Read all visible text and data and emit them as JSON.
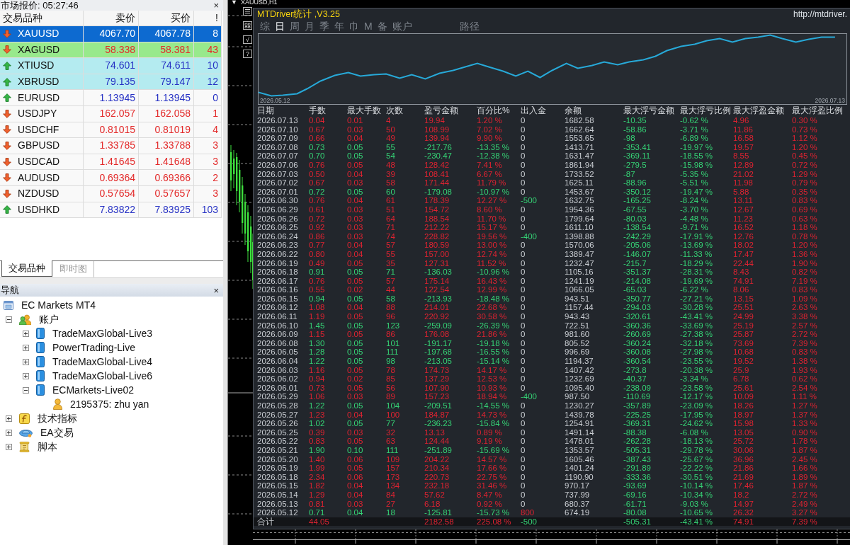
{
  "market_watch": {
    "title": "市场报价: 05:27:46",
    "close": "×",
    "columns": [
      "交易品种",
      "卖价",
      "买价",
      "!"
    ],
    "rows": [
      {
        "symbol": "XAUUSD",
        "bid": "4067.70",
        "ask": "4067.78",
        "spread": "8",
        "kind": "down",
        "selected": true
      },
      {
        "symbol": "XAGUSD",
        "bid": "58.338",
        "ask": "58.381",
        "spread": "43",
        "kind": "down",
        "selected": false,
        "color": "#98e98c"
      },
      {
        "symbol": "XTIUSD",
        "bid": "74.601",
        "ask": "74.611",
        "spread": "10",
        "kind": "up",
        "selected": false,
        "color": "#b4ebf0"
      },
      {
        "symbol": "XBRUSD",
        "bid": "79.135",
        "ask": "79.147",
        "spread": "12",
        "kind": "up",
        "selected": false,
        "color": "#b4ebf0"
      },
      {
        "symbol": "EURUSD",
        "bid": "1.13945",
        "ask": "1.13945",
        "spread": "0",
        "kind": "up",
        "selected": false
      },
      {
        "symbol": "USDJPY",
        "bid": "162.057",
        "ask": "162.058",
        "spread": "1",
        "kind": "down",
        "selected": false
      },
      {
        "symbol": "USDCHF",
        "bid": "0.81015",
        "ask": "0.81019",
        "spread": "4",
        "kind": "down",
        "selected": false
      },
      {
        "symbol": "GBPUSD",
        "bid": "1.33785",
        "ask": "1.33788",
        "spread": "3",
        "kind": "down",
        "selected": false
      },
      {
        "symbol": "USDCAD",
        "bid": "1.41645",
        "ask": "1.41648",
        "spread": "3",
        "kind": "down",
        "selected": false
      },
      {
        "symbol": "AUDUSD",
        "bid": "0.69364",
        "ask": "0.69366",
        "spread": "2",
        "kind": "down",
        "selected": false
      },
      {
        "symbol": "NZDUSD",
        "bid": "0.57654",
        "ask": "0.57657",
        "spread": "3",
        "kind": "down",
        "selected": false
      },
      {
        "symbol": "USDHKD",
        "bid": "7.83822",
        "ask": "7.83925",
        "spread": "103",
        "kind": "up",
        "selected": false
      }
    ]
  },
  "panel_tabs": [
    {
      "label": "交易品种",
      "selected": true
    },
    {
      "label": "即时图",
      "selected": false
    }
  ],
  "navigator": {
    "title": "导航",
    "close": "×",
    "tree": [
      {
        "kind": "terminal",
        "label": "EC Markets MT4",
        "children": [
          {
            "kind": "accounts",
            "label": "账户",
            "expanded": true,
            "children": [
              {
                "kind": "server",
                "label": "TradeMaxGlobal-Live3",
                "expanded": false
              },
              {
                "kind": "server",
                "label": "PowerTrading-Live",
                "expanded": false
              },
              {
                "kind": "server",
                "label": "TradeMaxGlobal-Live4",
                "expanded": false
              },
              {
                "kind": "server",
                "label": "TradeMaxGlobal-Live6",
                "expanded": false
              },
              {
                "kind": "server",
                "label": "ECMarkets-Live02",
                "expanded": true,
                "children": [
                  {
                    "kind": "account",
                    "label": "2195375: zhu yan"
                  }
                ]
              }
            ]
          },
          {
            "kind": "indicators",
            "label": "技术指标",
            "expanded": false
          },
          {
            "kind": "experts",
            "label": "EA交易",
            "expanded": false
          },
          {
            "kind": "scripts",
            "label": "脚本",
            "expanded": false
          }
        ]
      }
    ]
  },
  "chart": {
    "caret": "▼",
    "symbol": "XAUUSD,H1",
    "tools": [
      "√",
      "?"
    ]
  },
  "stats_window": {
    "title": "MTDriver统计 ,V3.25",
    "link": "http://mtdriver.",
    "tabs": [
      {
        "label": "综",
        "selected": false
      },
      {
        "label": "日",
        "selected": true
      },
      {
        "label": "周",
        "selected": false
      },
      {
        "label": "月",
        "selected": false
      },
      {
        "label": "季",
        "selected": false
      },
      {
        "label": "年",
        "selected": false
      },
      {
        "label": "巾",
        "selected": false
      },
      {
        "label": "M",
        "selected": false
      },
      {
        "label": "备",
        "selected": false
      },
      {
        "label": "账户",
        "selected": false
      }
    ],
    "path_button": "路径",
    "curve": {
      "start_label": "2026.05.12",
      "end_label": "2026.07.13"
    },
    "table": {
      "columns": [
        "日期",
        "手数",
        "最大手数",
        "次数",
        "盈亏金额",
        "百分比%",
        "出入金",
        "余额",
        "最大浮亏金额",
        "最大浮亏比例",
        "最大浮盈金额",
        "最大浮盈比例"
      ],
      "rows": [
        {
          "cells": [
            "2026.07.13",
            "0.04",
            "0.01",
            "4",
            "19.94",
            "1.20 %",
            "0",
            "1682.58",
            "-10.35",
            "-0.62 %",
            "4.96",
            "0.30 %"
          ],
          "kind": "gain",
          "withdrawal": false,
          "deposit": false
        },
        {
          "cells": [
            "2026.07.10",
            "0.67",
            "0.03",
            "50",
            "108.99",
            "7.02 %",
            "0",
            "1662.64",
            "-58.86",
            "-3.71 %",
            "11.86",
            "0.73 %"
          ],
          "kind": "gain",
          "withdrawal": false,
          "deposit": false
        },
        {
          "cells": [
            "2026.07.09",
            "0.66",
            "0.04",
            "49",
            "139.94",
            "9.90 %",
            "0",
            "1553.65",
            "-98",
            "-6.89 %",
            "16.58",
            "1.12 %"
          ],
          "kind": "gain",
          "withdrawal": false,
          "deposit": false
        },
        {
          "cells": [
            "2026.07.08",
            "0.73",
            "0.05",
            "55",
            "-217.76",
            "-13.35 %",
            "0",
            "1413.71",
            "-353.41",
            "-19.97 %",
            "19.57",
            "1.20 %"
          ],
          "kind": "loss",
          "withdrawal": false,
          "deposit": false
        },
        {
          "cells": [
            "2026.07.07",
            "0.70",
            "0.05",
            "54",
            "-230.47",
            "-12.38 %",
            "0",
            "1631.47",
            "-369.11",
            "-18.55 %",
            "8.55",
            "0.45 %"
          ],
          "kind": "loss",
          "withdrawal": false,
          "deposit": false
        },
        {
          "cells": [
            "2026.07.06",
            "0.76",
            "0.05",
            "48",
            "128.42",
            "7.41 %",
            "0",
            "1861.94",
            "-279.5",
            "-15.98 %",
            "12.89",
            "0.72 %"
          ],
          "kind": "gain",
          "withdrawal": false,
          "deposit": false
        },
        {
          "cells": [
            "2026.07.03",
            "0.50",
            "0.04",
            "39",
            "108.41",
            "6.67 %",
            "0",
            "1733.52",
            "-87",
            "-5.35 %",
            "21.02",
            "1.29 %"
          ],
          "kind": "gain",
          "withdrawal": false,
          "deposit": false
        },
        {
          "cells": [
            "2026.07.02",
            "0.67",
            "0.03",
            "58",
            "171.44",
            "11.79 %",
            "0",
            "1625.11",
            "-88.96",
            "-5.51 %",
            "11.98",
            "0.79 %"
          ],
          "kind": "gain",
          "withdrawal": false,
          "deposit": false
        },
        {
          "cells": [
            "2026.07.01",
            "0.72",
            "0.05",
            "60",
            "-179.08",
            "-10.97 %",
            "0",
            "1453.67",
            "-350.12",
            "-19.47 %",
            "5.88",
            "0.35 %"
          ],
          "kind": "loss",
          "withdrawal": false,
          "deposit": false
        },
        {
          "cells": [
            "2026.06.30",
            "0.76",
            "0.04",
            "61",
            "178.39",
            "12.27 %",
            "-500",
            "1632.75",
            "-165.25",
            "-8.24 %",
            "13.11",
            "0.83 %"
          ],
          "kind": "gain",
          "withdrawal": true,
          "deposit": false
        },
        {
          "cells": [
            "2026.06.29",
            "0.61",
            "0.03",
            "51",
            "154.72",
            "8.60 %",
            "0",
            "1954.36",
            "-67.55",
            "-3.70 %",
            "12.67",
            "0.69 %"
          ],
          "kind": "gain",
          "withdrawal": false,
          "deposit": false
        },
        {
          "cells": [
            "2026.06.26",
            "0.72",
            "0.03",
            "64",
            "188.54",
            "11.70 %",
            "0",
            "1799.64",
            "-80.03",
            "-4.48 %",
            "11.23",
            "0.63 %"
          ],
          "kind": "gain",
          "withdrawal": false,
          "deposit": false
        },
        {
          "cells": [
            "2026.06.25",
            "0.92",
            "0.03",
            "71",
            "212.22",
            "15.17 %",
            "0",
            "1611.10",
            "-138.54",
            "-9.71 %",
            "16.52",
            "1.18 %"
          ],
          "kind": "gain",
          "withdrawal": false,
          "deposit": false
        },
        {
          "cells": [
            "2026.06.24",
            "0.86",
            "0.03",
            "74",
            "228.82",
            "19.56 %",
            "-400",
            "1398.88",
            "-242.29",
            "-17.91 %",
            "12.76",
            "0.78 %"
          ],
          "kind": "gain",
          "withdrawal": true,
          "deposit": false
        },
        {
          "cells": [
            "2026.06.23",
            "0.77",
            "0.04",
            "57",
            "180.59",
            "13.00 %",
            "0",
            "1570.06",
            "-205.06",
            "-13.69 %",
            "18.02",
            "1.20 %"
          ],
          "kind": "gain",
          "withdrawal": false,
          "deposit": false
        },
        {
          "cells": [
            "2026.06.22",
            "0.80",
            "0.04",
            "55",
            "157.00",
            "12.74 %",
            "0",
            "1389.47",
            "-146.07",
            "-11.33 %",
            "17.47",
            "1.36 %"
          ],
          "kind": "gain",
          "withdrawal": false,
          "deposit": false
        },
        {
          "cells": [
            "2026.06.19",
            "0.49",
            "0.05",
            "35",
            "127.31",
            "11.52 %",
            "0",
            "1232.47",
            "-215.7",
            "-18.29 %",
            "22.44",
            "1.90 %"
          ],
          "kind": "gain",
          "withdrawal": false,
          "deposit": false
        },
        {
          "cells": [
            "2026.06.18",
            "0.91",
            "0.05",
            "71",
            "-136.03",
            "-10.96 %",
            "0",
            "1105.16",
            "-351.37",
            "-28.31 %",
            "8.43",
            "0.82 %"
          ],
          "kind": "loss",
          "withdrawal": false,
          "deposit": false
        },
        {
          "cells": [
            "2026.06.17",
            "0.76",
            "0.05",
            "57",
            "175.14",
            "16.43 %",
            "0",
            "1241.19",
            "-214.08",
            "-19.69 %",
            "74.91",
            "7.19 %"
          ],
          "kind": "gain",
          "withdrawal": false,
          "deposit": false
        },
        {
          "cells": [
            "2026.06.16",
            "0.55",
            "0.02",
            "44",
            "122.54",
            "12.99 %",
            "0",
            "1066.05",
            "-65.03",
            "-6.22 %",
            "8.06",
            "0.83 %"
          ],
          "kind": "gain",
          "withdrawal": false,
          "deposit": false
        },
        {
          "cells": [
            "2026.06.15",
            "0.94",
            "0.05",
            "58",
            "-213.93",
            "-18.48 %",
            "0",
            "943.51",
            "-350.77",
            "-27.21 %",
            "13.15",
            "1.09 %"
          ],
          "kind": "loss",
          "withdrawal": false,
          "deposit": false
        },
        {
          "cells": [
            "2026.06.12",
            "1.08",
            "0.04",
            "88",
            "214.01",
            "22.68 %",
            "0",
            "1157.44",
            "-294.03",
            "-30.28 %",
            "25.51",
            "2.63 %"
          ],
          "kind": "gain",
          "withdrawal": false,
          "deposit": false
        },
        {
          "cells": [
            "2026.06.11",
            "1.19",
            "0.05",
            "96",
            "220.92",
            "30.58 %",
            "0",
            "943.43",
            "-320.61",
            "-43.41 %",
            "24.99",
            "3.38 %"
          ],
          "kind": "gain",
          "withdrawal": false,
          "deposit": false
        },
        {
          "cells": [
            "2026.06.10",
            "1.45",
            "0.05",
            "123",
            "-259.09",
            "-26.39 %",
            "0",
            "722.51",
            "-360.36",
            "-33.69 %",
            "25.19",
            "2.57 %"
          ],
          "kind": "loss",
          "withdrawal": false,
          "deposit": false
        },
        {
          "cells": [
            "2026.06.09",
            "1.15",
            "0.05",
            "86",
            "176.08",
            "21.86 %",
            "0",
            "981.60",
            "-260.69",
            "-27.38 %",
            "25.87",
            "2.72 %"
          ],
          "kind": "gain",
          "withdrawal": false,
          "deposit": false
        },
        {
          "cells": [
            "2026.06.08",
            "1.30",
            "0.05",
            "101",
            "-191.17",
            "-19.18 %",
            "0",
            "805.52",
            "-360.24",
            "-32.18 %",
            "73.69",
            "7.39 %"
          ],
          "kind": "loss",
          "withdrawal": false,
          "deposit": false
        },
        {
          "cells": [
            "2026.06.05",
            "1.28",
            "0.05",
            "111",
            "-197.68",
            "-16.55 %",
            "0",
            "996.69",
            "-360.08",
            "-27.98 %",
            "10.68",
            "0.83 %"
          ],
          "kind": "loss",
          "withdrawal": false,
          "deposit": false
        },
        {
          "cells": [
            "2026.06.04",
            "1.22",
            "0.05",
            "98",
            "-213.05",
            "-15.14 %",
            "0",
            "1194.37",
            "-360.54",
            "-23.55 %",
            "19.52",
            "1.38 %"
          ],
          "kind": "loss",
          "withdrawal": false,
          "deposit": false
        },
        {
          "cells": [
            "2026.06.03",
            "1.16",
            "0.05",
            "78",
            "174.73",
            "14.17 %",
            "0",
            "1407.42",
            "-273.8",
            "-20.38 %",
            "25.9",
            "1.93 %"
          ],
          "kind": "gain",
          "withdrawal": false,
          "deposit": false
        },
        {
          "cells": [
            "2026.06.02",
            "0.94",
            "0.02",
            "85",
            "137.29",
            "12.53 %",
            "0",
            "1232.69",
            "-40.37",
            "-3.34 %",
            "6.78",
            "0.62 %"
          ],
          "kind": "gain",
          "withdrawal": false,
          "deposit": false
        },
        {
          "cells": [
            "2026.06.01",
            "0.73",
            "0.05",
            "56",
            "107.90",
            "10.93 %",
            "0",
            "1095.40",
            "-238.09",
            "-23.58 %",
            "25.61",
            "2.54 %"
          ],
          "kind": "gain",
          "withdrawal": false,
          "deposit": false
        },
        {
          "cells": [
            "2026.05.29",
            "1.06",
            "0.03",
            "89",
            "157.23",
            "18.94 %",
            "-400",
            "987.50",
            "-110.69",
            "-12.17 %",
            "10.09",
            "1.11 %"
          ],
          "kind": "gain",
          "withdrawal": true,
          "deposit": false
        },
        {
          "cells": [
            "2026.05.28",
            "1.22",
            "0.05",
            "104",
            "-209.51",
            "-14.55 %",
            "0",
            "1230.27",
            "-357.89",
            "-23.09 %",
            "18.26",
            "1.27 %"
          ],
          "kind": "loss",
          "withdrawal": false,
          "deposit": false
        },
        {
          "cells": [
            "2026.05.27",
            "1.23",
            "0.04",
            "100",
            "184.87",
            "14.73 %",
            "0",
            "1439.78",
            "-225.25",
            "-17.95 %",
            "18.97",
            "1.37 %"
          ],
          "kind": "gain",
          "withdrawal": false,
          "deposit": false
        },
        {
          "cells": [
            "2026.05.26",
            "1.02",
            "0.05",
            "77",
            "-236.23",
            "-15.84 %",
            "0",
            "1254.91",
            "-369.31",
            "-24.62 %",
            "15.98",
            "1.33 %"
          ],
          "kind": "loss",
          "withdrawal": false,
          "deposit": false
        },
        {
          "cells": [
            "2026.05.25",
            "0.39",
            "0.03",
            "32",
            "13.13",
            "0.89 %",
            "0",
            "1491.14",
            "-88.38",
            "-6.08 %",
            "13.05",
            "0.90 %"
          ],
          "kind": "gain",
          "withdrawal": false,
          "deposit": false
        },
        {
          "cells": [
            "2026.05.22",
            "0.83",
            "0.05",
            "63",
            "124.44",
            "9.19 %",
            "0",
            "1478.01",
            "-262.28",
            "-18.13 %",
            "25.72",
            "1.78 %"
          ],
          "kind": "gain",
          "withdrawal": false,
          "deposit": false
        },
        {
          "cells": [
            "2026.05.21",
            "1.90",
            "0.10",
            "111",
            "-251.89",
            "-15.69 %",
            "0",
            "1353.57",
            "-505.31",
            "-29.78 %",
            "30.06",
            "1.87 %"
          ],
          "kind": "loss",
          "withdrawal": false,
          "deposit": false
        },
        {
          "cells": [
            "2026.05.20",
            "1.40",
            "0.06",
            "109",
            "204.22",
            "14.57 %",
            "0",
            "1605.46",
            "-387.43",
            "-25.67 %",
            "36.96",
            "2.45 %"
          ],
          "kind": "gain",
          "withdrawal": false,
          "deposit": false
        },
        {
          "cells": [
            "2026.05.19",
            "1.99",
            "0.05",
            "157",
            "210.34",
            "17.66 %",
            "0",
            "1401.24",
            "-291.89",
            "-22.22 %",
            "21.86",
            "1.66 %"
          ],
          "kind": "gain",
          "withdrawal": false,
          "deposit": false
        },
        {
          "cells": [
            "2026.05.18",
            "2.34",
            "0.06",
            "173",
            "220.73",
            "22.75 %",
            "0",
            "1190.90",
            "-333.36",
            "-30.51 %",
            "21.69",
            "1.89 %"
          ],
          "kind": "gain",
          "withdrawal": false,
          "deposit": false
        },
        {
          "cells": [
            "2026.05.15",
            "1.82",
            "0.04",
            "134",
            "232.18",
            "31.46 %",
            "0",
            "970.17",
            "-93.69",
            "-10.14 %",
            "17.46",
            "1.87 %"
          ],
          "kind": "gain",
          "withdrawal": false,
          "deposit": false
        },
        {
          "cells": [
            "2026.05.14",
            "1.29",
            "0.04",
            "84",
            "57.62",
            "8.47 %",
            "0",
            "737.99",
            "-69.16",
            "-10.34 %",
            "18.2",
            "2.72 %"
          ],
          "kind": "gain",
          "withdrawal": false,
          "deposit": false
        },
        {
          "cells": [
            "2026.05.13",
            "0.81",
            "0.03",
            "27",
            "6.18",
            "0.92 %",
            "0",
            "680.37",
            "-61.71",
            "-9.03 %",
            "14.97",
            "2.49 %"
          ],
          "kind": "gain",
          "withdrawal": false,
          "deposit": false
        },
        {
          "cells": [
            "2026.05.12",
            "0.71",
            "0.04",
            "18",
            "-125.81",
            "-15.73 %",
            "800",
            "674.19",
            "-80.08",
            "-10.65 %",
            "26.32",
            "3.27 %"
          ],
          "kind": "loss",
          "withdrawal": false,
          "deposit": true
        }
      ],
      "total": {
        "label": "合计",
        "lots": "44.05",
        "pnl": "2182.58",
        "percent": "225.08 %",
        "cash_flow": "-500",
        "max_float_loss": "-505.31",
        "max_float_loss_pct": "-43.41 %",
        "max_float_profit": "74.91",
        "max_float_profit_pct": "7.39 %",
        "kind": "gain",
        "withdrawal": true,
        "deposit": false
      }
    }
  }
}
